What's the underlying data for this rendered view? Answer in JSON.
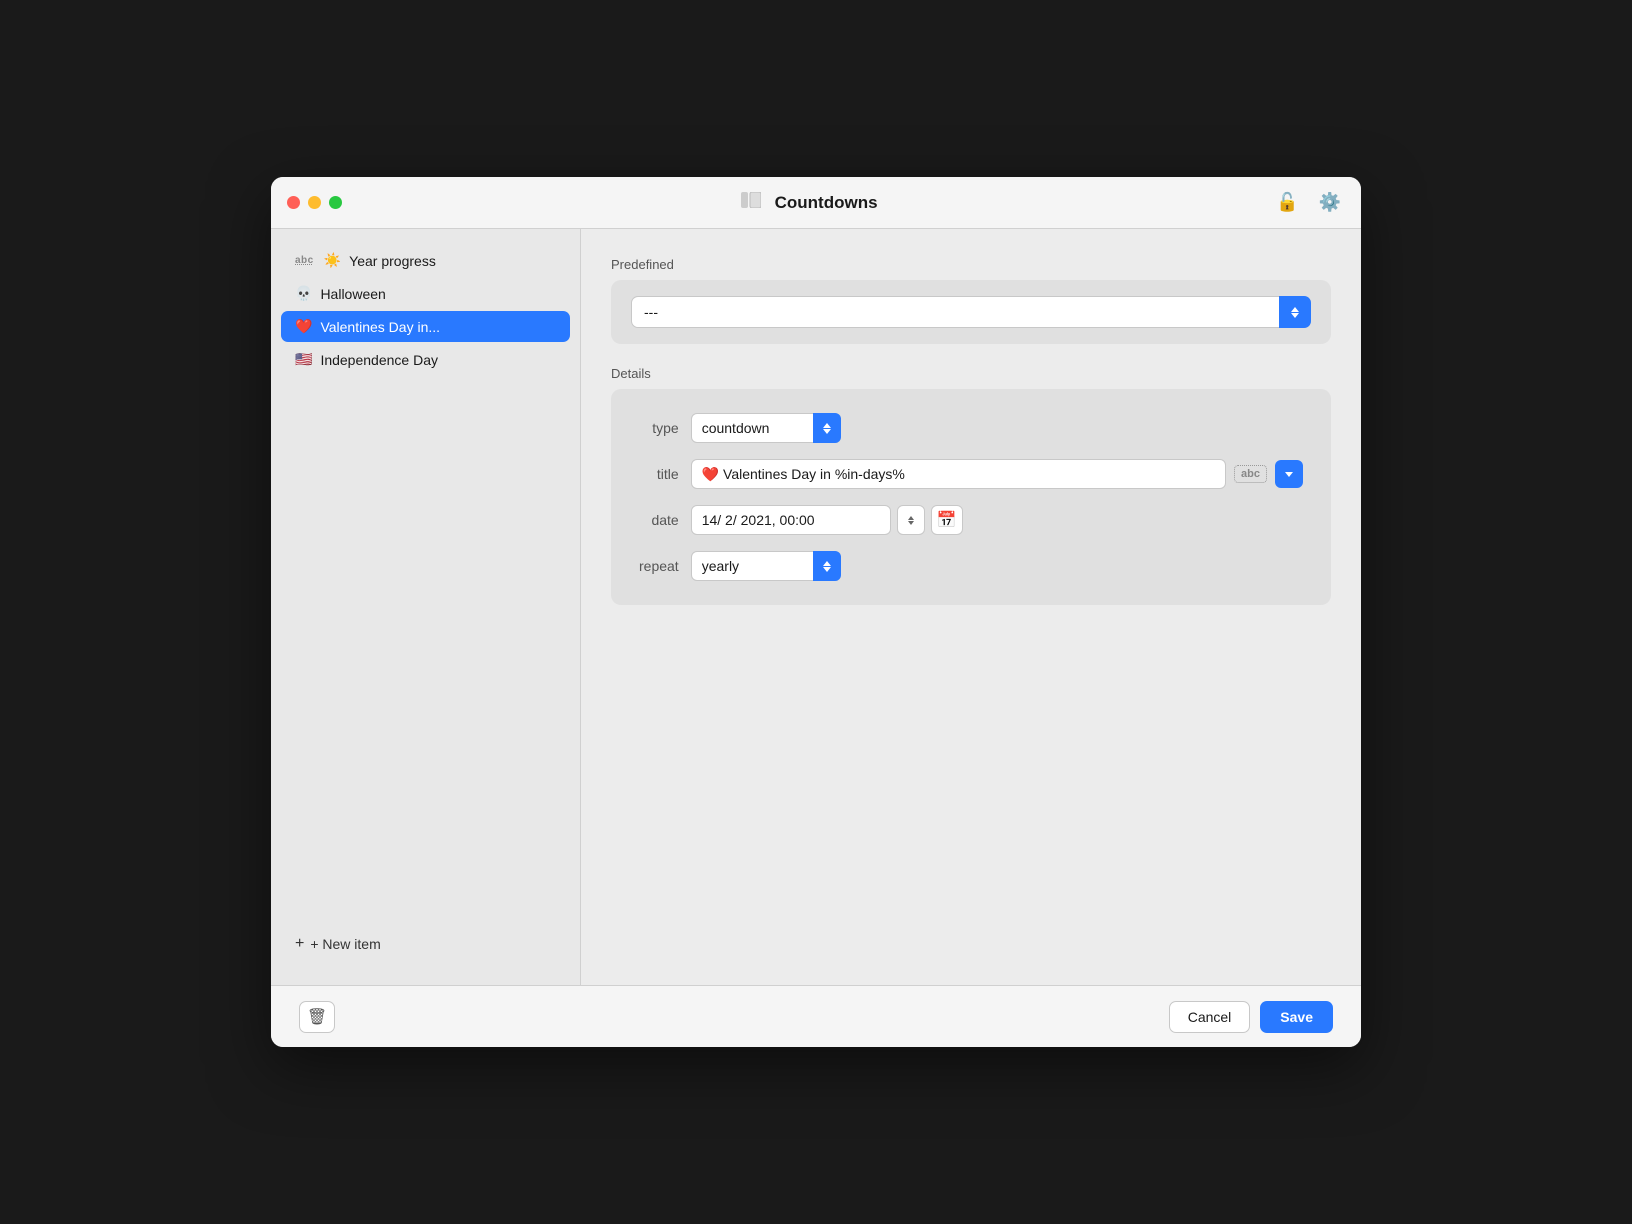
{
  "window": {
    "title": "Countdowns"
  },
  "sidebar": {
    "items": [
      {
        "id": "year-progress",
        "emoji": "☀️",
        "label": "Year progress",
        "hasAbc": true,
        "active": false
      },
      {
        "id": "halloween",
        "emoji": "💀",
        "label": "Halloween",
        "hasAbc": false,
        "active": false
      },
      {
        "id": "valentines",
        "emoji": "❤️",
        "label": "Valentines Day in...",
        "hasAbc": false,
        "active": true
      },
      {
        "id": "independence-day",
        "emoji": "🇺🇸",
        "label": "Independence Day",
        "hasAbc": false,
        "active": false
      }
    ],
    "new_item_label": "+ New item"
  },
  "content": {
    "predefined_label": "Predefined",
    "predefined_value": "---",
    "details_label": "Details",
    "fields": {
      "type_label": "type",
      "type_value": "countdown",
      "title_label": "title",
      "title_value": "❤️ Valentines Day in %in-days%",
      "date_label": "date",
      "date_value": "14/ 2/ 2021, 00:00",
      "repeat_label": "repeat",
      "repeat_value": "yearly"
    }
  },
  "bottom": {
    "cancel_label": "Cancel",
    "save_label": "Save"
  },
  "icons": {
    "sidebar_toggle": "⊞",
    "lock": "🔓",
    "gear": "⚙️",
    "delete": "🗑",
    "calendar": "📅"
  }
}
